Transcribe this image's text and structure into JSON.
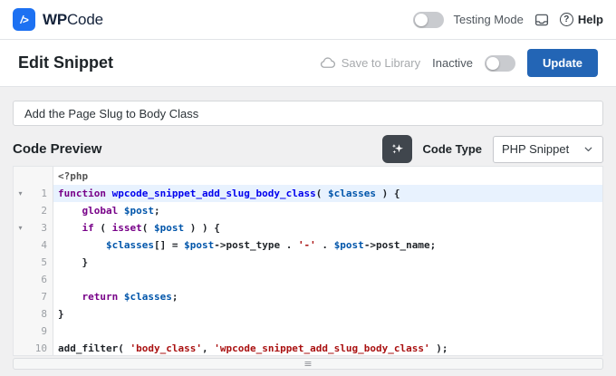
{
  "header": {
    "logo_glyph": "/>",
    "logo_text_bold": "WP",
    "logo_text_regular": "Code",
    "testing_mode_label": "Testing Mode",
    "help_label": "Help"
  },
  "toolbar": {
    "page_title": "Edit Snippet",
    "save_to_library_label": "Save to Library",
    "inactive_label": "Inactive",
    "update_label": "Update"
  },
  "snippet": {
    "title_value": "Add the Page Slug to Body Class"
  },
  "code_section": {
    "title": "Code Preview",
    "code_type_label": "Code Type",
    "code_type_value": "PHP Snippet"
  },
  "editor": {
    "php_open_tag": "<?php",
    "fold_glyph": "▾",
    "grip_glyph": "≡",
    "lines": [
      {
        "n": 1,
        "fold": true,
        "active": true,
        "tokens": [
          [
            "kw",
            "function"
          ],
          [
            "pl",
            " "
          ],
          [
            "def",
            "wpcode_snippet_add_slug_body_class"
          ],
          [
            "pl",
            "( "
          ],
          [
            "var",
            "$classes"
          ],
          [
            "pl",
            " ) {"
          ]
        ]
      },
      {
        "n": 2,
        "tokens": [
          [
            "pl",
            "    "
          ],
          [
            "kw",
            "global"
          ],
          [
            "pl",
            " "
          ],
          [
            "var",
            "$post"
          ],
          [
            "pl",
            ";"
          ]
        ]
      },
      {
        "n": 3,
        "fold": true,
        "tokens": [
          [
            "pl",
            "    "
          ],
          [
            "kw",
            "if"
          ],
          [
            "pl",
            " ( "
          ],
          [
            "kw",
            "isset"
          ],
          [
            "pl",
            "( "
          ],
          [
            "var",
            "$post"
          ],
          [
            "pl",
            " ) ) {"
          ]
        ]
      },
      {
        "n": 4,
        "tokens": [
          [
            "pl",
            "        "
          ],
          [
            "var",
            "$classes"
          ],
          [
            "pl",
            "[] = "
          ],
          [
            "var",
            "$post"
          ],
          [
            "pl",
            "->post_type . "
          ],
          [
            "str",
            "'-'"
          ],
          [
            "pl",
            " . "
          ],
          [
            "var",
            "$post"
          ],
          [
            "pl",
            "->post_name;"
          ]
        ]
      },
      {
        "n": 5,
        "tokens": [
          [
            "pl",
            "    }"
          ]
        ]
      },
      {
        "n": 6,
        "tokens": []
      },
      {
        "n": 7,
        "tokens": [
          [
            "pl",
            "    "
          ],
          [
            "kw",
            "return"
          ],
          [
            "pl",
            " "
          ],
          [
            "var",
            "$classes"
          ],
          [
            "pl",
            ";"
          ]
        ]
      },
      {
        "n": 8,
        "tokens": [
          [
            "pl",
            "}"
          ]
        ]
      },
      {
        "n": 9,
        "tokens": []
      },
      {
        "n": 10,
        "tokens": [
          [
            "pl",
            "add_filter( "
          ],
          [
            "str",
            "'body_class'"
          ],
          [
            "pl",
            ", "
          ],
          [
            "str",
            "'wpcode_snippet_add_slug_body_class'"
          ],
          [
            "pl",
            " );"
          ]
        ]
      }
    ]
  },
  "colors": {
    "brand_blue": "#1d71f2",
    "update_button_blue": "#2365b5",
    "page_background": "#f0f0f1",
    "active_line_background": "#e8f2fe",
    "syntax": {
      "kw": "#770088",
      "def": "#0000ee",
      "var": "#0055aa",
      "str": "#aa1111",
      "meta": "#555555",
      "pl": "#1f2328"
    }
  }
}
